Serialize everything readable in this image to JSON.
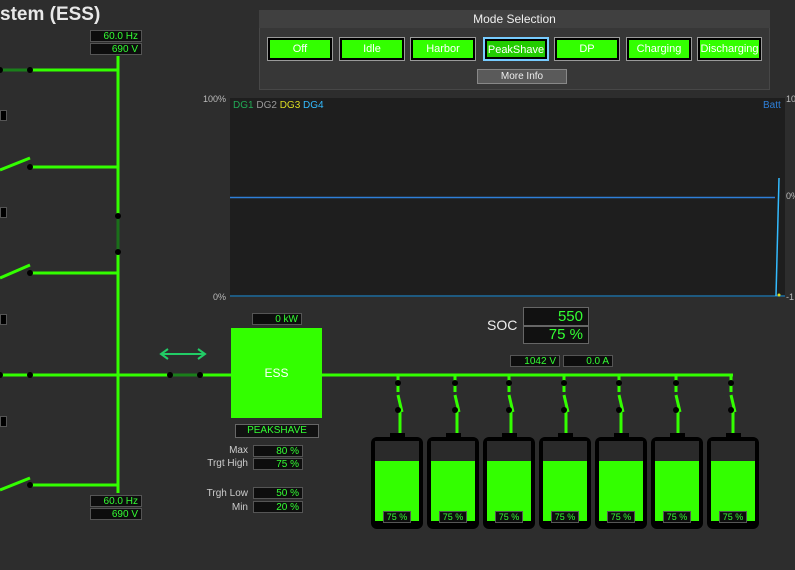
{
  "title": "stem (ESS)",
  "colors": {
    "bus": "#33ff00",
    "accent": "#33ff00",
    "background": "#2d2d2d",
    "dg1": "#22aa55",
    "dg2": "#999999",
    "dg3": "#dddd22",
    "dg4": "#33bbff",
    "batt": "#2e7fd8"
  },
  "top_bus": {
    "freq": "60.0 Hz",
    "volt": "690 V"
  },
  "bottom_bus": {
    "freq": "60.0 Hz",
    "volt": "690 V"
  },
  "mode_selection": {
    "title": "Mode Selection",
    "buttons": [
      {
        "label": "Off"
      },
      {
        "label": "Idle"
      },
      {
        "label": "Harbor"
      },
      {
        "label": "PeakShave",
        "active": true
      },
      {
        "label": "DP"
      },
      {
        "label": "Charging"
      },
      {
        "label": "Discharging"
      }
    ],
    "more_info": "More Info"
  },
  "trend": {
    "ymax_left": "100%",
    "ymin_left": "0%",
    "ymax_right": "10",
    "ymid_right": "0%",
    "ymin_right": "-1",
    "legend": [
      "DG1",
      "DG2",
      "DG3",
      "DG4"
    ],
    "right_legend": "Batt"
  },
  "chart_data": {
    "type": "line",
    "series": [
      {
        "name": "Batt",
        "values": [
          50,
          50,
          50,
          50,
          50,
          50,
          50,
          50,
          50,
          50
        ]
      }
    ]
  },
  "ess": {
    "power": "0 kW",
    "label": "ESS",
    "mode": "PEAKSHAVE",
    "settings": [
      {
        "label": "Max",
        "value": "80 %"
      },
      {
        "label": "Trgt High",
        "value": "75 %"
      },
      {
        "label": "Trgh Low",
        "value": "50 %"
      },
      {
        "label": "Min",
        "value": "20 %"
      }
    ]
  },
  "soc": {
    "label": "SOC",
    "energy": "550 kWh",
    "percent": "75 %"
  },
  "dc_bus": {
    "volt": "1042 V",
    "current": "0.0 A"
  },
  "batteries": [
    {
      "label": "75 %",
      "level": 0.75
    },
    {
      "label": "75 %",
      "level": 0.75
    },
    {
      "label": "75 %",
      "level": 0.75
    },
    {
      "label": "75 %",
      "level": 0.75
    },
    {
      "label": "75 %",
      "level": 0.75
    },
    {
      "label": "75 %",
      "level": 0.75
    },
    {
      "label": "75 %",
      "level": 0.75
    }
  ]
}
